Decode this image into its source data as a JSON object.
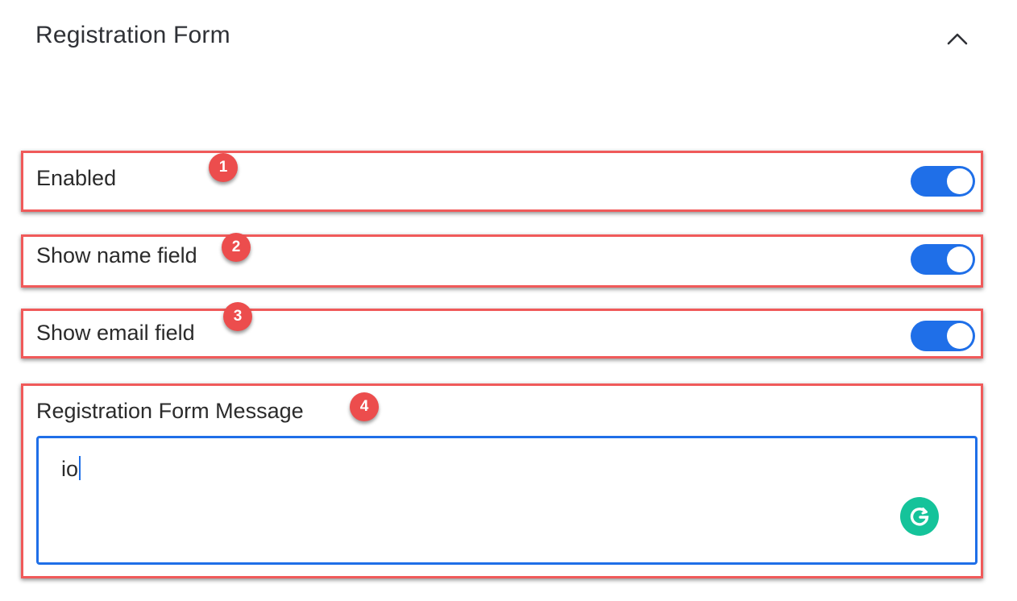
{
  "panel": {
    "title": "Registration Form",
    "collapse_icon": "chevron-up-icon"
  },
  "settings": [
    {
      "label": "Enabled",
      "badge": "1",
      "enabled": true
    },
    {
      "label": "Show name field",
      "badge": "2",
      "enabled": true
    },
    {
      "label": "Show email field",
      "badge": "3",
      "enabled": true
    }
  ],
  "message": {
    "label": "Registration Form Message",
    "badge": "4",
    "value": "io",
    "assistant_icon": "grammarly-icon"
  },
  "colors": {
    "accent": "#1f6fe8",
    "annotation": "#ec4d4d",
    "grammarly": "#15c39a"
  }
}
